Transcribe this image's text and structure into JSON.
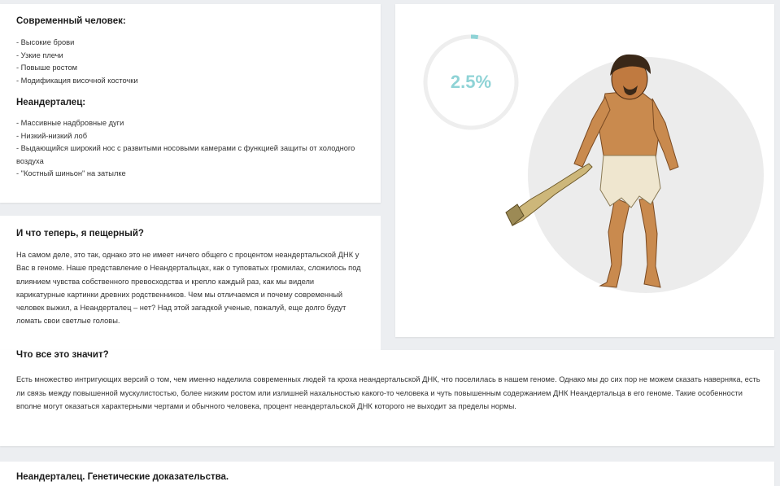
{
  "modern": {
    "title": "Современный человек:",
    "traits": [
      "- Высокие брови",
      "- Узкие плечи",
      "- Повыше ростом",
      "- Модификация височной косточки"
    ]
  },
  "neanderthal": {
    "title": "Неандерталец:",
    "traits": [
      "- Массивные надбровные дуги",
      "- Низкий-низкий лоб",
      "- Выдающийся широкий нос с развитыми носовыми камерами с функцией защиты от холодного воздуха",
      "- \"Костный шиньон\" на затылке"
    ]
  },
  "cave": {
    "title": "И что теперь, я пещерный?",
    "text": "На самом деле, это так, однако это не имеет ничего общего с процентом неандертальской ДНК у Вас в геноме. Наше представление о Неандертальцах, как о туповатых громилах, сложилось под влиянием чувства собственного превосходства и крепло каждый раз, как мы видели карикатурные картинки древних родственников. Чем мы отличаемся и почему современный человек выжил, а Неандерталец – нет? Над этой загадкой ученые, пожалуй, еще долго будут ломать свои светлые головы."
  },
  "gauge": {
    "label": "2.5%",
    "value": 0.025,
    "color": "#8fd3d6",
    "track_color": "#eeeeee"
  },
  "meaning": {
    "title": "Что все это значит?",
    "text": "Есть множество интригующих версий о том, чем именно наделила современных людей та кроха неандертальской ДНК, что поселилась в нашем геноме. Однако мы до сих пор не можем сказать наверняка, есть ли связь между повышенной мускулистостью, более низким ростом или излишней нахальностью какого-то человека и чуть повышенным содержанием ДНК Неандертальца в его геноме. Такие особенности вполне могут оказаться характерными чертами и обычного человека, процент неандертальской ДНК которого не выходит за пределы нормы."
  },
  "next": {
    "title": "Неандерталец. Генетические доказательства."
  }
}
